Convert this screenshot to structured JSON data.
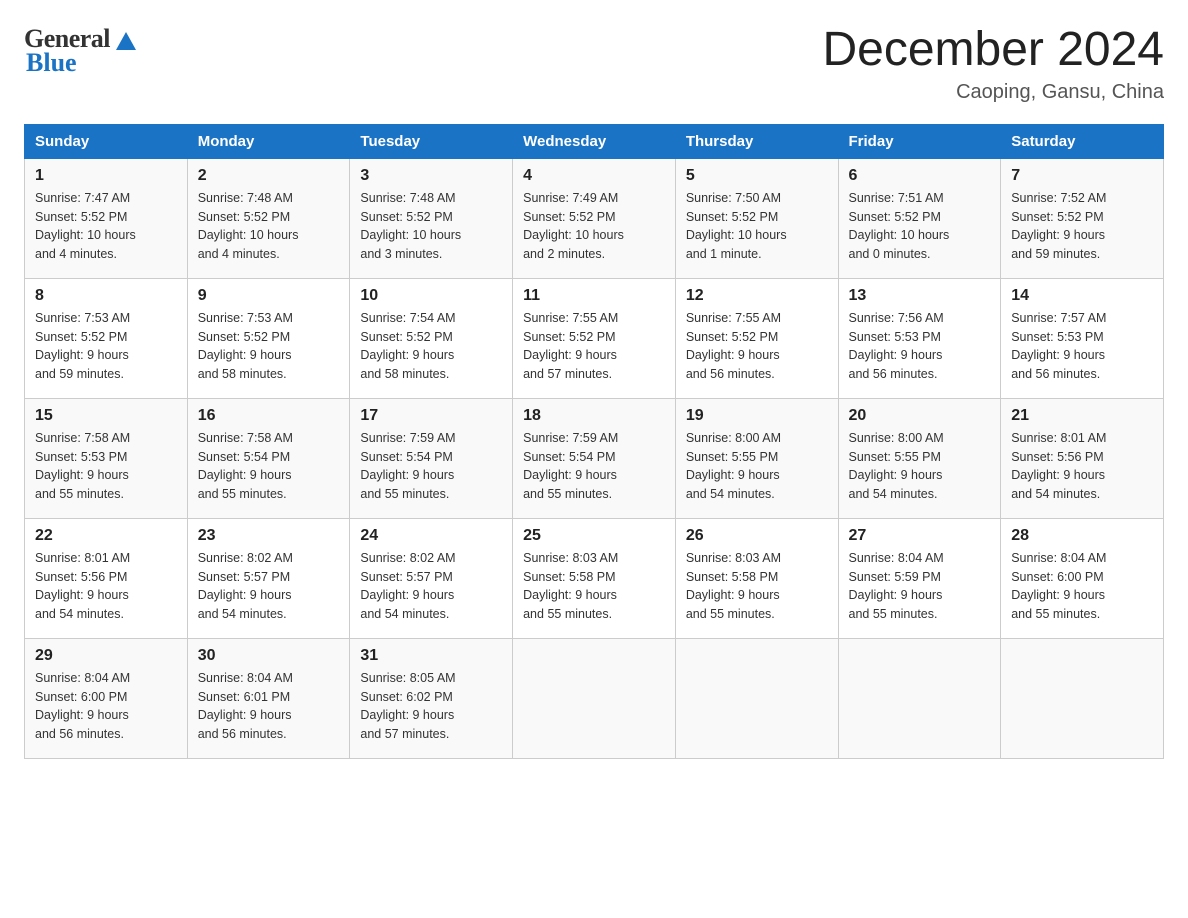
{
  "header": {
    "logo_text_main": "General",
    "logo_text_blue": "Blue",
    "month_title": "December 2024",
    "subtitle": "Caoping, Gansu, China"
  },
  "days_of_week": [
    "Sunday",
    "Monday",
    "Tuesday",
    "Wednesday",
    "Thursday",
    "Friday",
    "Saturday"
  ],
  "weeks": [
    [
      {
        "day": "1",
        "sunrise": "7:47 AM",
        "sunset": "5:52 PM",
        "daylight": "10 hours and 4 minutes."
      },
      {
        "day": "2",
        "sunrise": "7:48 AM",
        "sunset": "5:52 PM",
        "daylight": "10 hours and 4 minutes."
      },
      {
        "day": "3",
        "sunrise": "7:48 AM",
        "sunset": "5:52 PM",
        "daylight": "10 hours and 3 minutes."
      },
      {
        "day": "4",
        "sunrise": "7:49 AM",
        "sunset": "5:52 PM",
        "daylight": "10 hours and 2 minutes."
      },
      {
        "day": "5",
        "sunrise": "7:50 AM",
        "sunset": "5:52 PM",
        "daylight": "10 hours and 1 minute."
      },
      {
        "day": "6",
        "sunrise": "7:51 AM",
        "sunset": "5:52 PM",
        "daylight": "10 hours and 0 minutes."
      },
      {
        "day": "7",
        "sunrise": "7:52 AM",
        "sunset": "5:52 PM",
        "daylight": "9 hours and 59 minutes."
      }
    ],
    [
      {
        "day": "8",
        "sunrise": "7:53 AM",
        "sunset": "5:52 PM",
        "daylight": "9 hours and 59 minutes."
      },
      {
        "day": "9",
        "sunrise": "7:53 AM",
        "sunset": "5:52 PM",
        "daylight": "9 hours and 58 minutes."
      },
      {
        "day": "10",
        "sunrise": "7:54 AM",
        "sunset": "5:52 PM",
        "daylight": "9 hours and 58 minutes."
      },
      {
        "day": "11",
        "sunrise": "7:55 AM",
        "sunset": "5:52 PM",
        "daylight": "9 hours and 57 minutes."
      },
      {
        "day": "12",
        "sunrise": "7:55 AM",
        "sunset": "5:52 PM",
        "daylight": "9 hours and 56 minutes."
      },
      {
        "day": "13",
        "sunrise": "7:56 AM",
        "sunset": "5:53 PM",
        "daylight": "9 hours and 56 minutes."
      },
      {
        "day": "14",
        "sunrise": "7:57 AM",
        "sunset": "5:53 PM",
        "daylight": "9 hours and 56 minutes."
      }
    ],
    [
      {
        "day": "15",
        "sunrise": "7:58 AM",
        "sunset": "5:53 PM",
        "daylight": "9 hours and 55 minutes."
      },
      {
        "day": "16",
        "sunrise": "7:58 AM",
        "sunset": "5:54 PM",
        "daylight": "9 hours and 55 minutes."
      },
      {
        "day": "17",
        "sunrise": "7:59 AM",
        "sunset": "5:54 PM",
        "daylight": "9 hours and 55 minutes."
      },
      {
        "day": "18",
        "sunrise": "7:59 AM",
        "sunset": "5:54 PM",
        "daylight": "9 hours and 55 minutes."
      },
      {
        "day": "19",
        "sunrise": "8:00 AM",
        "sunset": "5:55 PM",
        "daylight": "9 hours and 54 minutes."
      },
      {
        "day": "20",
        "sunrise": "8:00 AM",
        "sunset": "5:55 PM",
        "daylight": "9 hours and 54 minutes."
      },
      {
        "day": "21",
        "sunrise": "8:01 AM",
        "sunset": "5:56 PM",
        "daylight": "9 hours and 54 minutes."
      }
    ],
    [
      {
        "day": "22",
        "sunrise": "8:01 AM",
        "sunset": "5:56 PM",
        "daylight": "9 hours and 54 minutes."
      },
      {
        "day": "23",
        "sunrise": "8:02 AM",
        "sunset": "5:57 PM",
        "daylight": "9 hours and 54 minutes."
      },
      {
        "day": "24",
        "sunrise": "8:02 AM",
        "sunset": "5:57 PM",
        "daylight": "9 hours and 54 minutes."
      },
      {
        "day": "25",
        "sunrise": "8:03 AM",
        "sunset": "5:58 PM",
        "daylight": "9 hours and 55 minutes."
      },
      {
        "day": "26",
        "sunrise": "8:03 AM",
        "sunset": "5:58 PM",
        "daylight": "9 hours and 55 minutes."
      },
      {
        "day": "27",
        "sunrise": "8:04 AM",
        "sunset": "5:59 PM",
        "daylight": "9 hours and 55 minutes."
      },
      {
        "day": "28",
        "sunrise": "8:04 AM",
        "sunset": "6:00 PM",
        "daylight": "9 hours and 55 minutes."
      }
    ],
    [
      {
        "day": "29",
        "sunrise": "8:04 AM",
        "sunset": "6:00 PM",
        "daylight": "9 hours and 56 minutes."
      },
      {
        "day": "30",
        "sunrise": "8:04 AM",
        "sunset": "6:01 PM",
        "daylight": "9 hours and 56 minutes."
      },
      {
        "day": "31",
        "sunrise": "8:05 AM",
        "sunset": "6:02 PM",
        "daylight": "9 hours and 57 minutes."
      },
      null,
      null,
      null,
      null
    ]
  ],
  "labels": {
    "sunrise": "Sunrise:",
    "sunset": "Sunset:",
    "daylight": "Daylight:"
  }
}
